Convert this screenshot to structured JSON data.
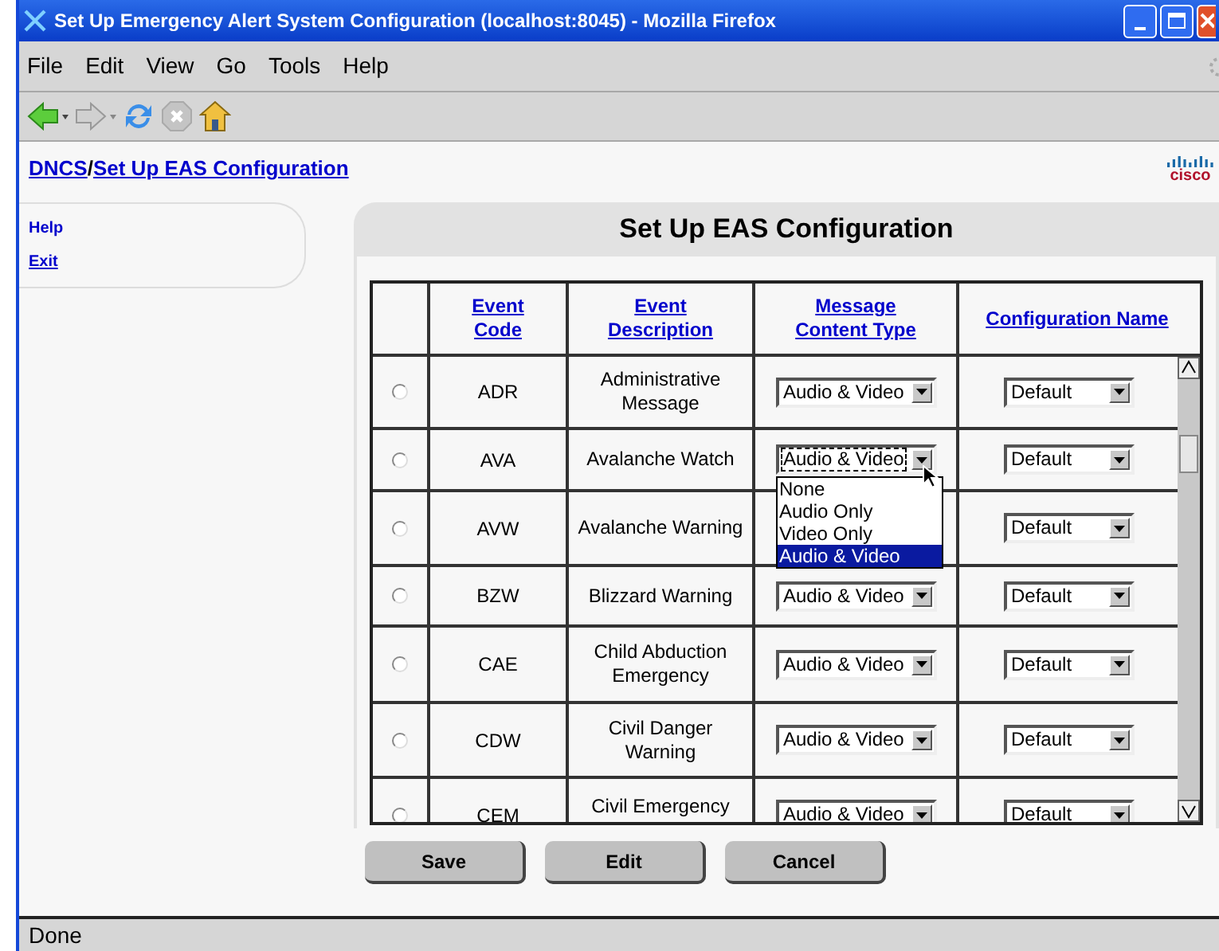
{
  "window": {
    "title": "Set Up Emergency Alert System Configuration (localhost:8045) - Mozilla Firefox"
  },
  "menu": [
    "File",
    "Edit",
    "View",
    "Go",
    "Tools",
    "Help"
  ],
  "breadcrumb": [
    {
      "label": "DNCS"
    },
    {
      "label": "Set Up EAS Configuration"
    }
  ],
  "breadcrumb_separator": "/",
  "logo": {
    "text": "cisco"
  },
  "sidebar": {
    "items": [
      {
        "label": "Help",
        "underlined": false
      },
      {
        "label": "Exit",
        "underlined": true
      }
    ]
  },
  "panel": {
    "title": "Set Up EAS Configuration"
  },
  "table": {
    "columns": [
      "Event Code",
      "Event Description",
      "Message Content Type",
      "Configuration Name"
    ],
    "rows": [
      {
        "selected": false,
        "code": "ADR",
        "description": "Administrative Message",
        "content_type": "Audio & Video",
        "config": "Default"
      },
      {
        "selected": false,
        "code": "AVA",
        "description": "Avalanche Watch",
        "content_type": "Audio & Video",
        "config": "Default",
        "menu": {
          "options": [
            {
              "label": "None",
              "selected": false
            },
            {
              "label": "Audio Only",
              "selected": false
            },
            {
              "label": "Video Only",
              "selected": false
            },
            {
              "label": "Audio & Video",
              "selected": true
            }
          ]
        }
      },
      {
        "selected": false,
        "code": "AVW",
        "description": "Avalanche Warning",
        "config": "Default"
      },
      {
        "selected": false,
        "code": "BZW",
        "description": "Blizzard Warning",
        "content_type": "Audio & Video",
        "config": "Default"
      },
      {
        "selected": false,
        "code": "CAE",
        "description": "Child Abduction Emergency",
        "content_type": "Audio & Video",
        "config": "Default"
      },
      {
        "selected": false,
        "code": "CDW",
        "description": "Civil Danger Warning",
        "content_type": "Audio & Video",
        "config": "Default"
      },
      {
        "selected": false,
        "code": "CEM",
        "description": "Civil Emergency",
        "content_type": "Audio & Video",
        "config": "Default"
      }
    ]
  },
  "buttons": [
    "Save",
    "Edit",
    "Cancel"
  ],
  "status_bar": "Done"
}
